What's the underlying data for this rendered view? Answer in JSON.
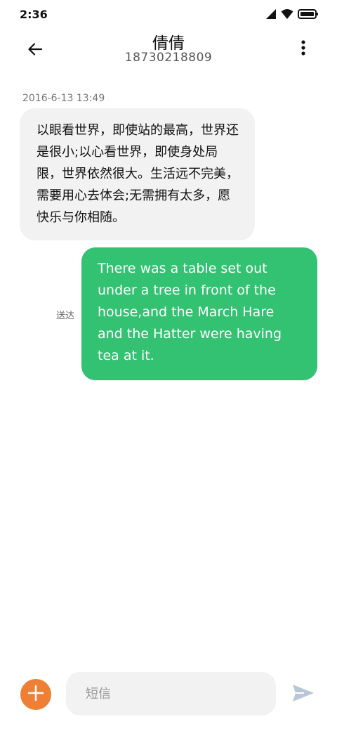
{
  "status_bar": {
    "time": "2:36",
    "icons": [
      "signal-icon",
      "wifi-icon",
      "battery-icon"
    ]
  },
  "header": {
    "back_icon": "arrow-left-icon",
    "contact_name": "倩倩",
    "contact_number": "18730218809",
    "more_icon": "more-vertical-icon"
  },
  "conversation": {
    "timestamp": "2016-6-13 13:49",
    "incoming_message": "以眼看世界，即使站的最高，世界还是很小;以心看世界，即使身处局限，世界依然很大。生活远不完美，需要用心去体会;无需拥有太多，愿快乐与你相随。",
    "outgoing_message": "There was a table set out under a tree in front of the house,and the March Hare and the Hatter were having tea at it.",
    "outgoing_status": "送达"
  },
  "composer": {
    "add_icon": "plus-icon",
    "placeholder": "短信",
    "value": "",
    "send_icon": "send-icon"
  },
  "colors": {
    "outgoing_bubble": "#33c172",
    "incoming_bubble": "#f2f2f2",
    "add_button": "#ee7f35",
    "send_icon": "#b8c6d6"
  }
}
